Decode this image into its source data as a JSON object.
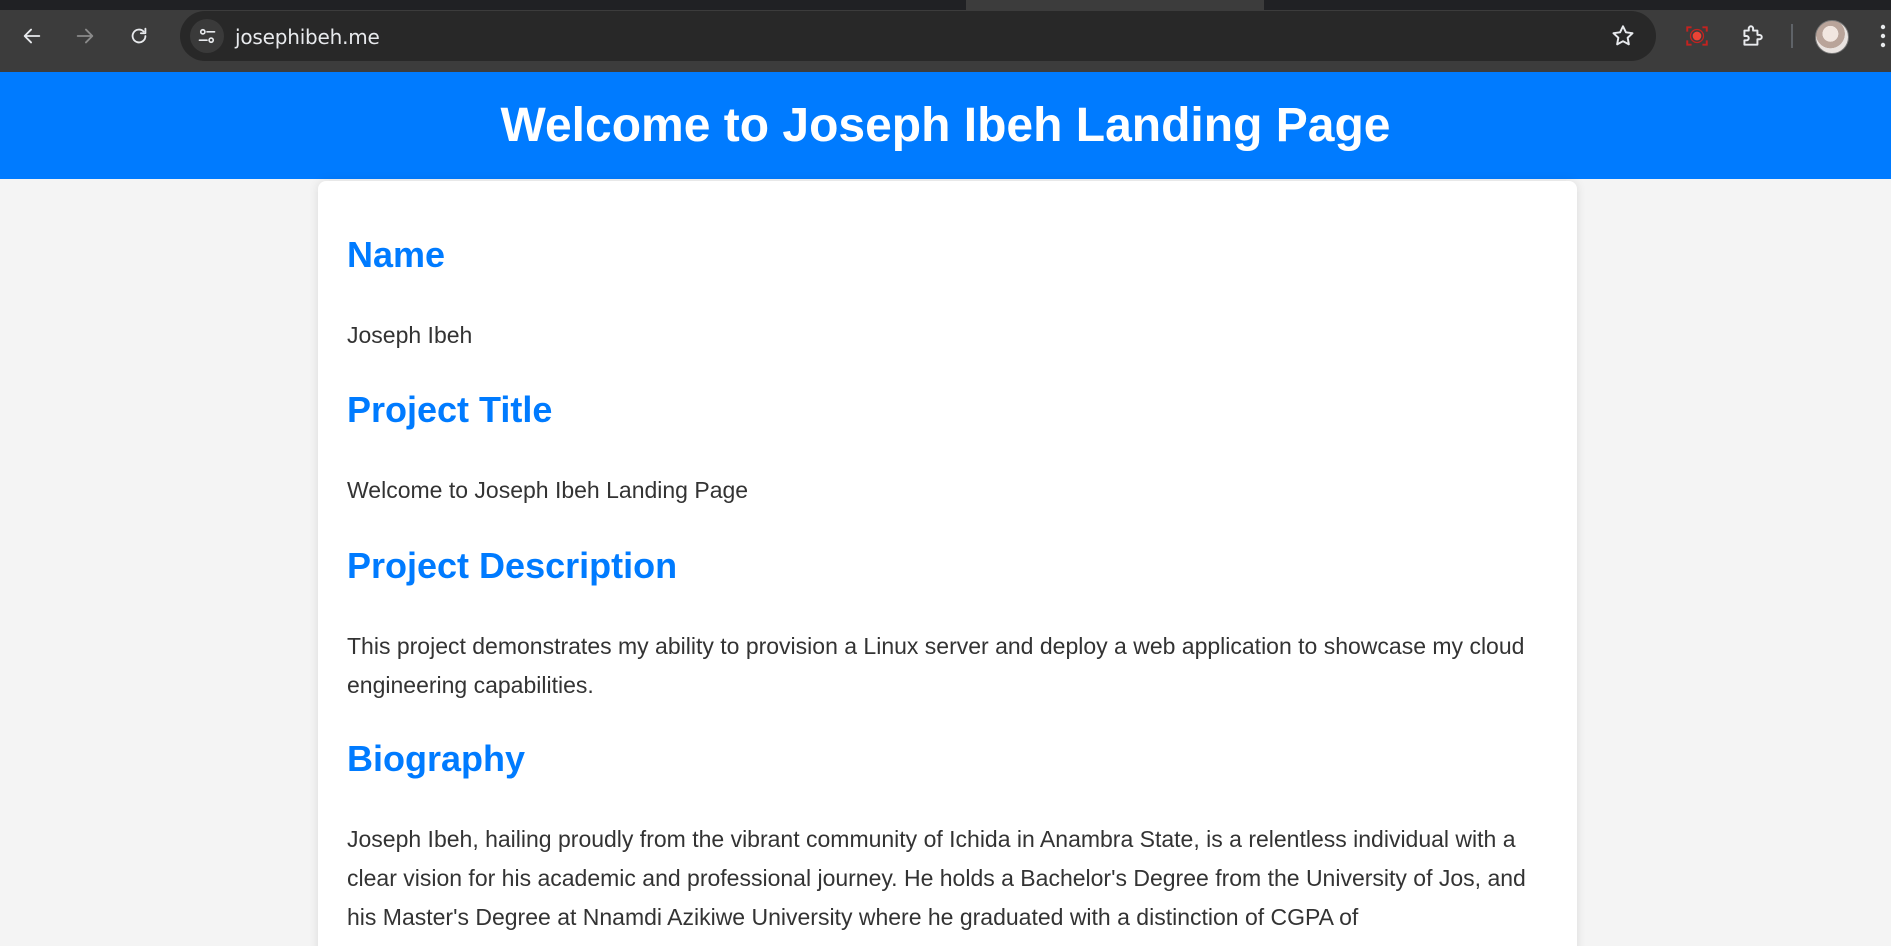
{
  "browser": {
    "url": "josephibeh.me"
  },
  "hero": {
    "title": "Welcome to Joseph Ibeh Landing Page",
    "background": "#007bff"
  },
  "sections": [
    {
      "heading": "Name",
      "text": "Joseph Ibeh"
    },
    {
      "heading": "Project Title",
      "text": "Welcome to Joseph Ibeh Landing Page"
    },
    {
      "heading": "Project Description",
      "text": "This project demonstrates my ability to provision a Linux server and deploy a web application to showcase my cloud engineering capabilities."
    },
    {
      "heading": "Biography",
      "text": "Joseph Ibeh, hailing proudly from the vibrant community of Ichida in Anambra State, is a relentless individual with a clear vision for his academic and professional journey. He holds a Bachelor's Degree from the University of Jos, and his Master's Degree at Nnamdi Azikiwe University where he graduated with a distinction of CGPA of"
    }
  ],
  "colors": {
    "accent": "#007bff",
    "heading": "#007bff",
    "body_text": "#333333",
    "page_bg": "#f4f4f4",
    "chrome_bg": "#3c3c3c"
  },
  "icons": {
    "back": "arrow-left-icon",
    "forward": "arrow-right-icon",
    "reload": "reload-icon",
    "site_info": "tune-icon",
    "bookmark": "star-icon",
    "screen_record": "record-icon",
    "extensions": "puzzle-icon",
    "profile": "avatar",
    "menu": "more-vert-icon"
  }
}
